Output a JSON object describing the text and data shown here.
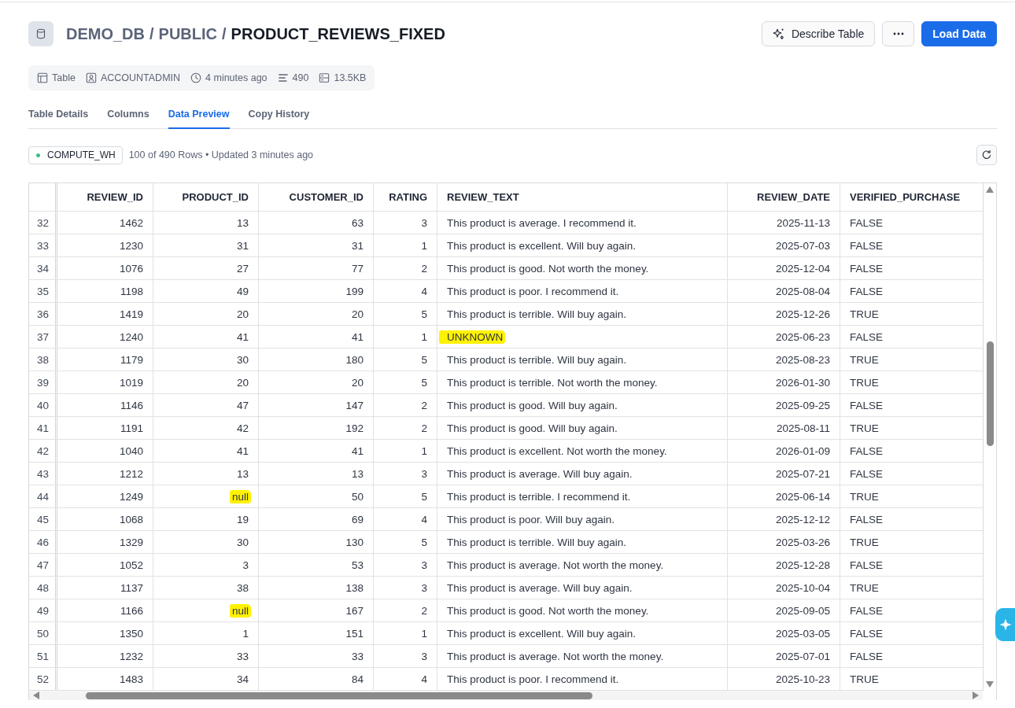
{
  "header": {
    "breadcrumb": [
      {
        "kind": "link",
        "text": "DEMO_DB"
      },
      {
        "kind": "separator",
        "text": "/"
      },
      {
        "kind": "link",
        "text": "PUBLIC"
      },
      {
        "kind": "separator",
        "text": "/"
      },
      {
        "kind": "current",
        "text": "PRODUCT_REVIEWS_FIXED"
      }
    ],
    "actions": [
      {
        "kind": "ai",
        "label": "Describe Table"
      },
      {
        "kind": "more"
      },
      {
        "kind": "primary",
        "label": "Load Data"
      }
    ]
  },
  "meta": [
    {
      "kind": "type",
      "text": "Table"
    },
    {
      "kind": "owner",
      "text": "ACCOUNTADMIN"
    },
    {
      "kind": "created",
      "text": "4 minutes ago"
    },
    {
      "kind": "rows",
      "text": "490"
    },
    {
      "kind": "size",
      "text": "13.5KB"
    }
  ],
  "tabs": [
    {
      "label": "Table Details",
      "selected": false
    },
    {
      "label": "Columns",
      "selected": false
    },
    {
      "label": "Data Preview",
      "selected": true
    },
    {
      "label": "Copy History",
      "selected": false
    }
  ],
  "toolbar": {
    "warehouse": {
      "name": "COMPUTE_WH",
      "running": true
    },
    "summary": "100 of 490 Rows • Updated 3 minutes ago"
  },
  "table": {
    "columns": [
      {
        "label": "REVIEW_ID",
        "kind": "number"
      },
      {
        "label": "PRODUCT_ID",
        "kind": "number"
      },
      {
        "label": "CUSTOMER_ID",
        "kind": "number"
      },
      {
        "label": "RATING",
        "kind": "number"
      },
      {
        "label": "REVIEW_TEXT",
        "kind": "text"
      },
      {
        "label": "REVIEW_DATE",
        "kind": "number"
      },
      {
        "label": "VERIFIED_PURCHASE",
        "kind": "text"
      }
    ],
    "rows": [
      {
        "number": "32",
        "cells": [
          {
            "text": "1462",
            "highlighted": false
          },
          {
            "text": "13",
            "highlighted": false
          },
          {
            "text": "63",
            "highlighted": false
          },
          {
            "text": "3",
            "highlighted": false
          },
          {
            "text": "This product is average. I recommend it.",
            "highlighted": false
          },
          {
            "text": "2025-11-13",
            "highlighted": false
          },
          {
            "text": "FALSE",
            "highlighted": false
          }
        ]
      },
      {
        "number": "33",
        "cells": [
          {
            "text": "1230",
            "highlighted": false
          },
          {
            "text": "31",
            "highlighted": false
          },
          {
            "text": "31",
            "highlighted": false
          },
          {
            "text": "1",
            "highlighted": false
          },
          {
            "text": "This product is excellent. Will buy again.",
            "highlighted": false
          },
          {
            "text": "2025-07-03",
            "highlighted": false
          },
          {
            "text": "FALSE",
            "highlighted": false
          }
        ]
      },
      {
        "number": "34",
        "cells": [
          {
            "text": "1076",
            "highlighted": false
          },
          {
            "text": "27",
            "highlighted": false
          },
          {
            "text": "77",
            "highlighted": false
          },
          {
            "text": "2",
            "highlighted": false
          },
          {
            "text": "This product is good. Not worth the money.",
            "highlighted": false
          },
          {
            "text": "2025-12-04",
            "highlighted": false
          },
          {
            "text": "FALSE",
            "highlighted": false
          }
        ]
      },
      {
        "number": "35",
        "cells": [
          {
            "text": "1198",
            "highlighted": false
          },
          {
            "text": "49",
            "highlighted": false
          },
          {
            "text": "199",
            "highlighted": false
          },
          {
            "text": "4",
            "highlighted": false
          },
          {
            "text": "This product is poor. I recommend it.",
            "highlighted": false
          },
          {
            "text": "2025-08-04",
            "highlighted": false
          },
          {
            "text": "FALSE",
            "highlighted": false
          }
        ]
      },
      {
        "number": "36",
        "cells": [
          {
            "text": "1419",
            "highlighted": false
          },
          {
            "text": "20",
            "highlighted": false
          },
          {
            "text": "20",
            "highlighted": false
          },
          {
            "text": "5",
            "highlighted": false
          },
          {
            "text": "This product is terrible. Will buy again.",
            "highlighted": false
          },
          {
            "text": "2025-12-26",
            "highlighted": false
          },
          {
            "text": "TRUE",
            "highlighted": false
          }
        ]
      },
      {
        "number": "37",
        "cells": [
          {
            "text": "1240",
            "highlighted": false
          },
          {
            "text": "41",
            "highlighted": false
          },
          {
            "text": "41",
            "highlighted": false
          },
          {
            "text": "1",
            "highlighted": false
          },
          {
            "text": "UNKNOWN",
            "highlighted": true
          },
          {
            "text": "2025-06-23",
            "highlighted": false
          },
          {
            "text": "FALSE",
            "highlighted": false
          }
        ]
      },
      {
        "number": "38",
        "cells": [
          {
            "text": "1179",
            "highlighted": false
          },
          {
            "text": "30",
            "highlighted": false
          },
          {
            "text": "180",
            "highlighted": false
          },
          {
            "text": "5",
            "highlighted": false
          },
          {
            "text": "This product is terrible. Will buy again.",
            "highlighted": false
          },
          {
            "text": "2025-08-23",
            "highlighted": false
          },
          {
            "text": "TRUE",
            "highlighted": false
          }
        ]
      },
      {
        "number": "39",
        "cells": [
          {
            "text": "1019",
            "highlighted": false
          },
          {
            "text": "20",
            "highlighted": false
          },
          {
            "text": "20",
            "highlighted": false
          },
          {
            "text": "5",
            "highlighted": false
          },
          {
            "text": "This product is terrible. Not worth the money.",
            "highlighted": false
          },
          {
            "text": "2026-01-30",
            "highlighted": false
          },
          {
            "text": "TRUE",
            "highlighted": false
          }
        ]
      },
      {
        "number": "40",
        "cells": [
          {
            "text": "1146",
            "highlighted": false
          },
          {
            "text": "47",
            "highlighted": false
          },
          {
            "text": "147",
            "highlighted": false
          },
          {
            "text": "2",
            "highlighted": false
          },
          {
            "text": "This product is good. Will buy again.",
            "highlighted": false
          },
          {
            "text": "2025-09-25",
            "highlighted": false
          },
          {
            "text": "FALSE",
            "highlighted": false
          }
        ]
      },
      {
        "number": "41",
        "cells": [
          {
            "text": "1191",
            "highlighted": false
          },
          {
            "text": "42",
            "highlighted": false
          },
          {
            "text": "192",
            "highlighted": false
          },
          {
            "text": "2",
            "highlighted": false
          },
          {
            "text": "This product is good. Will buy again.",
            "highlighted": false
          },
          {
            "text": "2025-08-11",
            "highlighted": false
          },
          {
            "text": "TRUE",
            "highlighted": false
          }
        ]
      },
      {
        "number": "42",
        "cells": [
          {
            "text": "1040",
            "highlighted": false
          },
          {
            "text": "41",
            "highlighted": false
          },
          {
            "text": "41",
            "highlighted": false
          },
          {
            "text": "1",
            "highlighted": false
          },
          {
            "text": "This product is excellent. Not worth the money.",
            "highlighted": false
          },
          {
            "text": "2026-01-09",
            "highlighted": false
          },
          {
            "text": "FALSE",
            "highlighted": false
          }
        ]
      },
      {
        "number": "43",
        "cells": [
          {
            "text": "1212",
            "highlighted": false
          },
          {
            "text": "13",
            "highlighted": false
          },
          {
            "text": "13",
            "highlighted": false
          },
          {
            "text": "3",
            "highlighted": false
          },
          {
            "text": "This product is average. Will buy again.",
            "highlighted": false
          },
          {
            "text": "2025-07-21",
            "highlighted": false
          },
          {
            "text": "FALSE",
            "highlighted": false
          }
        ]
      },
      {
        "number": "44",
        "cells": [
          {
            "text": "1249",
            "highlighted": false
          },
          {
            "text": "null",
            "highlighted": true
          },
          {
            "text": "50",
            "highlighted": false
          },
          {
            "text": "5",
            "highlighted": false
          },
          {
            "text": "This product is terrible. I recommend it.",
            "highlighted": false
          },
          {
            "text": "2025-06-14",
            "highlighted": false
          },
          {
            "text": "TRUE",
            "highlighted": false
          }
        ]
      },
      {
        "number": "45",
        "cells": [
          {
            "text": "1068",
            "highlighted": false
          },
          {
            "text": "19",
            "highlighted": false
          },
          {
            "text": "69",
            "highlighted": false
          },
          {
            "text": "4",
            "highlighted": false
          },
          {
            "text": "This product is poor. Will buy again.",
            "highlighted": false
          },
          {
            "text": "2025-12-12",
            "highlighted": false
          },
          {
            "text": "FALSE",
            "highlighted": false
          }
        ]
      },
      {
        "number": "46",
        "cells": [
          {
            "text": "1329",
            "highlighted": false
          },
          {
            "text": "30",
            "highlighted": false
          },
          {
            "text": "130",
            "highlighted": false
          },
          {
            "text": "5",
            "highlighted": false
          },
          {
            "text": "This product is terrible. Will buy again.",
            "highlighted": false
          },
          {
            "text": "2025-03-26",
            "highlighted": false
          },
          {
            "text": "TRUE",
            "highlighted": false
          }
        ]
      },
      {
        "number": "47",
        "cells": [
          {
            "text": "1052",
            "highlighted": false
          },
          {
            "text": "3",
            "highlighted": false
          },
          {
            "text": "53",
            "highlighted": false
          },
          {
            "text": "3",
            "highlighted": false
          },
          {
            "text": "This product is average. Not worth the money.",
            "highlighted": false
          },
          {
            "text": "2025-12-28",
            "highlighted": false
          },
          {
            "text": "FALSE",
            "highlighted": false
          }
        ]
      },
      {
        "number": "48",
        "cells": [
          {
            "text": "1137",
            "highlighted": false
          },
          {
            "text": "38",
            "highlighted": false
          },
          {
            "text": "138",
            "highlighted": false
          },
          {
            "text": "3",
            "highlighted": false
          },
          {
            "text": "This product is average. Will buy again.",
            "highlighted": false
          },
          {
            "text": "2025-10-04",
            "highlighted": false
          },
          {
            "text": "TRUE",
            "highlighted": false
          }
        ]
      },
      {
        "number": "49",
        "cells": [
          {
            "text": "1166",
            "highlighted": false
          },
          {
            "text": "null",
            "highlighted": true
          },
          {
            "text": "167",
            "highlighted": false
          },
          {
            "text": "2",
            "highlighted": false
          },
          {
            "text": "This product is good. Not worth the money.",
            "highlighted": false
          },
          {
            "text": "2025-09-05",
            "highlighted": false
          },
          {
            "text": "FALSE",
            "highlighted": false
          }
        ]
      },
      {
        "number": "50",
        "cells": [
          {
            "text": "1350",
            "highlighted": false
          },
          {
            "text": "1",
            "highlighted": false
          },
          {
            "text": "151",
            "highlighted": false
          },
          {
            "text": "1",
            "highlighted": false
          },
          {
            "text": "This product is excellent. Will buy again.",
            "highlighted": false
          },
          {
            "text": "2025-03-05",
            "highlighted": false
          },
          {
            "text": "FALSE",
            "highlighted": false
          }
        ]
      },
      {
        "number": "51",
        "cells": [
          {
            "text": "1232",
            "highlighted": false
          },
          {
            "text": "33",
            "highlighted": false
          },
          {
            "text": "33",
            "highlighted": false
          },
          {
            "text": "3",
            "highlighted": false
          },
          {
            "text": "This product is average. Not worth the money.",
            "highlighted": false
          },
          {
            "text": "2025-07-01",
            "highlighted": false
          },
          {
            "text": "FALSE",
            "highlighted": false
          }
        ]
      },
      {
        "number": "52",
        "cells": [
          {
            "text": "1483",
            "highlighted": false
          },
          {
            "text": "34",
            "highlighted": false
          },
          {
            "text": "84",
            "highlighted": false
          },
          {
            "text": "4",
            "highlighted": false
          },
          {
            "text": "This product is poor. I recommend it.",
            "highlighted": false
          },
          {
            "text": "2025-10-23",
            "highlighted": false
          },
          {
            "text": "TRUE",
            "highlighted": false
          }
        ]
      }
    ]
  },
  "floating_button": {
    "kind": "assistant"
  }
}
